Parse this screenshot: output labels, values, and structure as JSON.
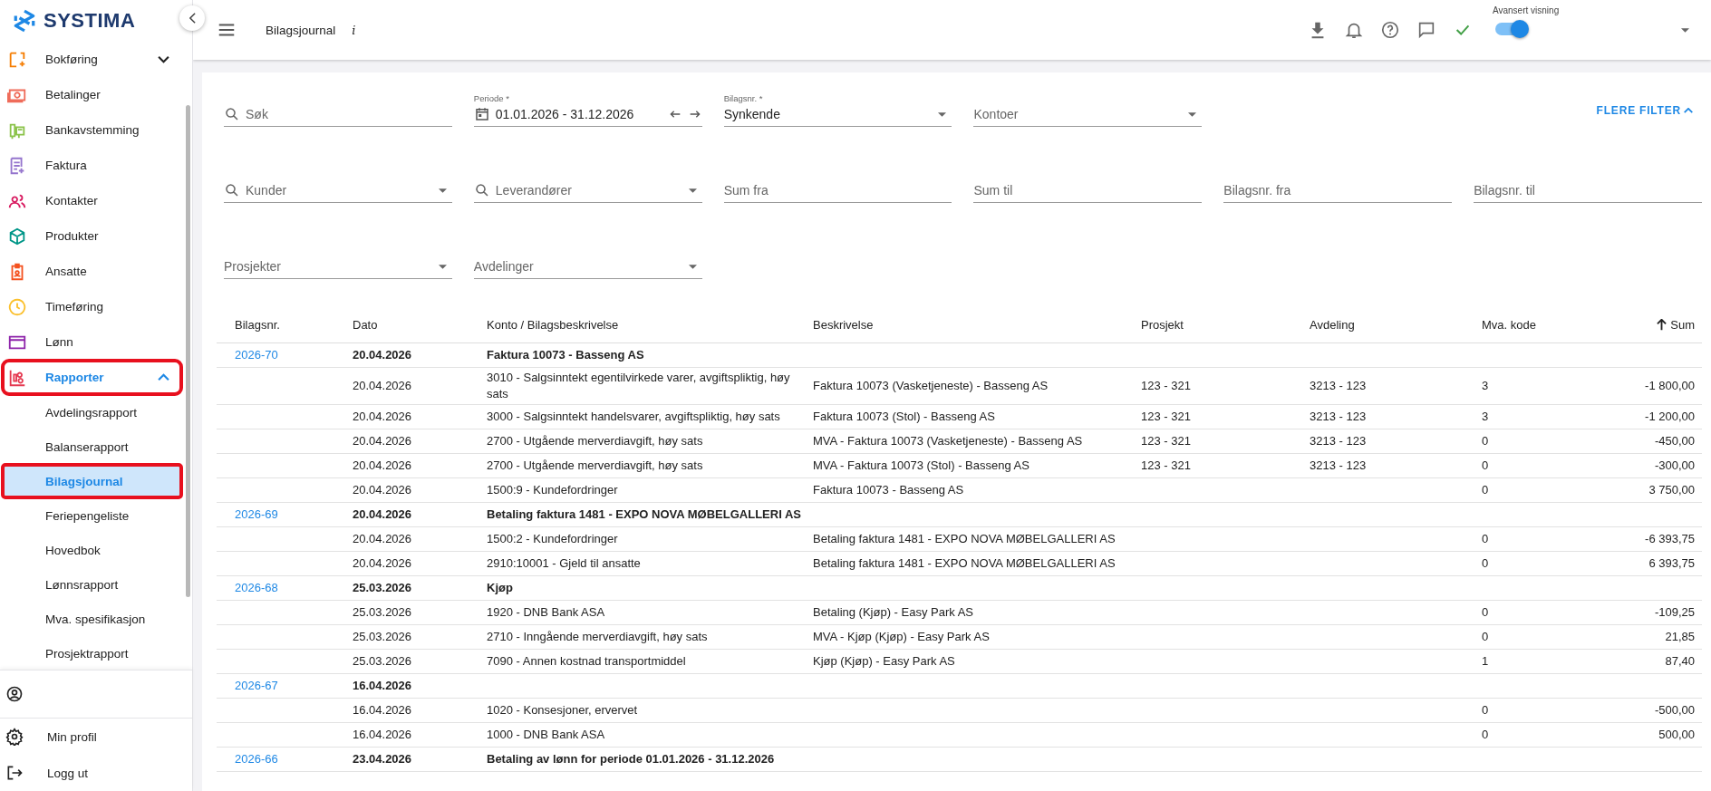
{
  "brand": {
    "name": "SYSTIMA"
  },
  "sidebar": {
    "items": [
      {
        "label": "Bokføring",
        "expanded": false,
        "selected": false,
        "annotated": false
      },
      {
        "label": "Betalinger",
        "selected": false,
        "annotated": false
      },
      {
        "label": "Bankavstemming",
        "selected": false,
        "annotated": false
      },
      {
        "label": "Faktura",
        "selected": false,
        "annotated": false
      },
      {
        "label": "Kontakter",
        "selected": false,
        "annotated": false
      },
      {
        "label": "Produkter",
        "selected": false,
        "annotated": false
      },
      {
        "label": "Ansatte",
        "selected": false,
        "annotated": false
      },
      {
        "label": "Timeføring",
        "selected": false,
        "annotated": false
      },
      {
        "label": "Lønn",
        "selected": false,
        "annotated": false
      },
      {
        "label": "Rapporter",
        "expanded": true,
        "selected": true,
        "annotated": true,
        "children": [
          {
            "label": "Avdelingsrapport",
            "selected": false,
            "annotated": false
          },
          {
            "label": "Balanserapport",
            "selected": false,
            "annotated": false
          },
          {
            "label": "Bilagsjournal",
            "selected": true,
            "annotated": true
          },
          {
            "label": "Feriepengeliste",
            "selected": false,
            "annotated": false
          },
          {
            "label": "Hovedbok",
            "selected": false,
            "annotated": false
          },
          {
            "label": "Lønnsrapport",
            "selected": false,
            "annotated": false
          },
          {
            "label": "Mva. spesifikasjon",
            "selected": false,
            "annotated": false
          },
          {
            "label": "Prosjektrapport",
            "selected": false,
            "annotated": false
          }
        ]
      }
    ],
    "footer": [
      {
        "kind": "user"
      },
      {
        "kind": "settings",
        "label": "Min profil"
      },
      {
        "kind": "logout",
        "label": "Logg ut"
      }
    ]
  },
  "topbar": {
    "title": "Bilagsjournal",
    "info": "i",
    "advanced_view": {
      "label": "Avansert visning",
      "on": true
    }
  },
  "filters": [
    {
      "kind": "search",
      "placeholder": "Søk"
    },
    {
      "kind": "period",
      "label": "Periode *",
      "value": "01.01.2026 - 31.12.2026"
    },
    {
      "kind": "select",
      "label": "Bilagsnr. *",
      "value": "Synkende"
    },
    {
      "kind": "select",
      "placeholder": "Kontoer"
    },
    {
      "kind": "button",
      "label": "FLERE FILTER"
    },
    {
      "kind": "search-select",
      "placeholder": "Kunder"
    },
    {
      "kind": "search-select",
      "placeholder": "Leverandører"
    },
    {
      "kind": "text",
      "placeholder": "Sum fra"
    },
    {
      "kind": "text",
      "placeholder": "Sum til"
    },
    {
      "kind": "text",
      "placeholder": "Bilagsnr. fra"
    },
    {
      "kind": "text",
      "placeholder": "Bilagsnr. til"
    },
    {
      "kind": "select",
      "placeholder": "Prosjekter"
    },
    {
      "kind": "select",
      "placeholder": "Avdelinger"
    }
  ],
  "table": {
    "columns": [
      {
        "label": "Bilagsnr.",
        "sorted": false
      },
      {
        "label": "Dato",
        "sorted": false
      },
      {
        "label": "Konto / Bilagsbeskrivelse",
        "sorted": false
      },
      {
        "label": "Beskrivelse",
        "sorted": false
      },
      {
        "label": "Prosjekt",
        "sorted": false
      },
      {
        "label": "Avdeling",
        "sorted": false
      },
      {
        "label": "Mva. kode",
        "sorted": false
      },
      {
        "label": "Sum",
        "sorted": true
      }
    ],
    "entries": [
      {
        "number": "2026-70",
        "date": "20.04.2026",
        "description": "Faktura 10073 - Basseng AS",
        "lines": [
          {
            "date": "20.04.2026",
            "account": "3010 - Salgsinntekt egentilvirkede varer, avgiftspliktig, høy sats",
            "description": "Faktura 10073 (Vasketjeneste) - Basseng AS",
            "project": "123 - 321",
            "department": "3213 - 123",
            "vat_code": "3",
            "sum": "-1 800,00"
          },
          {
            "date": "20.04.2026",
            "account": "3000 - Salgsinntekt handelsvarer, avgiftspliktig, høy sats",
            "description": "Faktura 10073 (Stol) - Basseng AS",
            "project": "123 - 321",
            "department": "3213 - 123",
            "vat_code": "3",
            "sum": "-1 200,00"
          },
          {
            "date": "20.04.2026",
            "account": "2700 - Utgående merverdiavgift, høy sats",
            "description": "MVA - Faktura 10073 (Vasketjeneste) - Basseng AS",
            "project": "123 - 321",
            "department": "3213 - 123",
            "vat_code": "0",
            "sum": "-450,00"
          },
          {
            "date": "20.04.2026",
            "account": "2700 - Utgående merverdiavgift, høy sats",
            "description": "MVA - Faktura 10073 (Stol) - Basseng AS",
            "project": "123 - 321",
            "department": "3213 - 123",
            "vat_code": "0",
            "sum": "-300,00"
          },
          {
            "date": "20.04.2026",
            "account": "1500:9 - Kundefordringer",
            "description": "Faktura 10073 - Basseng AS",
            "vat_code": "0",
            "sum": "3 750,00"
          }
        ]
      },
      {
        "number": "2026-69",
        "date": "20.04.2026",
        "description": "Betaling faktura 1481 - EXPO NOVA MØBELGALLERI AS",
        "lines": [
          {
            "date": "20.04.2026",
            "account": "1500:2 - Kundefordringer",
            "description": "Betaling faktura 1481 - EXPO NOVA MØBELGALLERI AS",
            "vat_code": "0",
            "sum": "-6 393,75"
          },
          {
            "date": "20.04.2026",
            "account": "2910:10001 - Gjeld til ansatte",
            "description": "Betaling faktura 1481 - EXPO NOVA MØBELGALLERI AS",
            "vat_code": "0",
            "sum": "6 393,75"
          }
        ]
      },
      {
        "number": "2026-68",
        "date": "25.03.2026",
        "description": "Kjøp",
        "lines": [
          {
            "date": "25.03.2026",
            "account": "1920 - DNB Bank ASA",
            "description": "Betaling (Kjøp) - Easy Park AS",
            "vat_code": "0",
            "sum": "-109,25"
          },
          {
            "date": "25.03.2026",
            "account": "2710 - Inngående merverdiavgift, høy sats",
            "description": "MVA - Kjøp (Kjøp) - Easy Park AS",
            "vat_code": "0",
            "sum": "21,85"
          },
          {
            "date": "25.03.2026",
            "account": "7090 - Annen kostnad transportmiddel",
            "description": "Kjøp (Kjøp) - Easy Park AS",
            "vat_code": "1",
            "sum": "87,40"
          }
        ]
      },
      {
        "number": "2026-67",
        "date": "16.04.2026",
        "lines": [
          {
            "date": "16.04.2026",
            "account": "1020 - Konsesjoner, ervervet",
            "vat_code": "0",
            "sum": "-500,00"
          },
          {
            "date": "16.04.2026",
            "account": "1000 - DNB Bank ASA",
            "vat_code": "0",
            "sum": "500,00"
          }
        ]
      },
      {
        "number": "2026-66",
        "date": "23.04.2026",
        "description": "Betaling av lønn for periode 01.01.2026 - 31.12.2026"
      }
    ]
  }
}
